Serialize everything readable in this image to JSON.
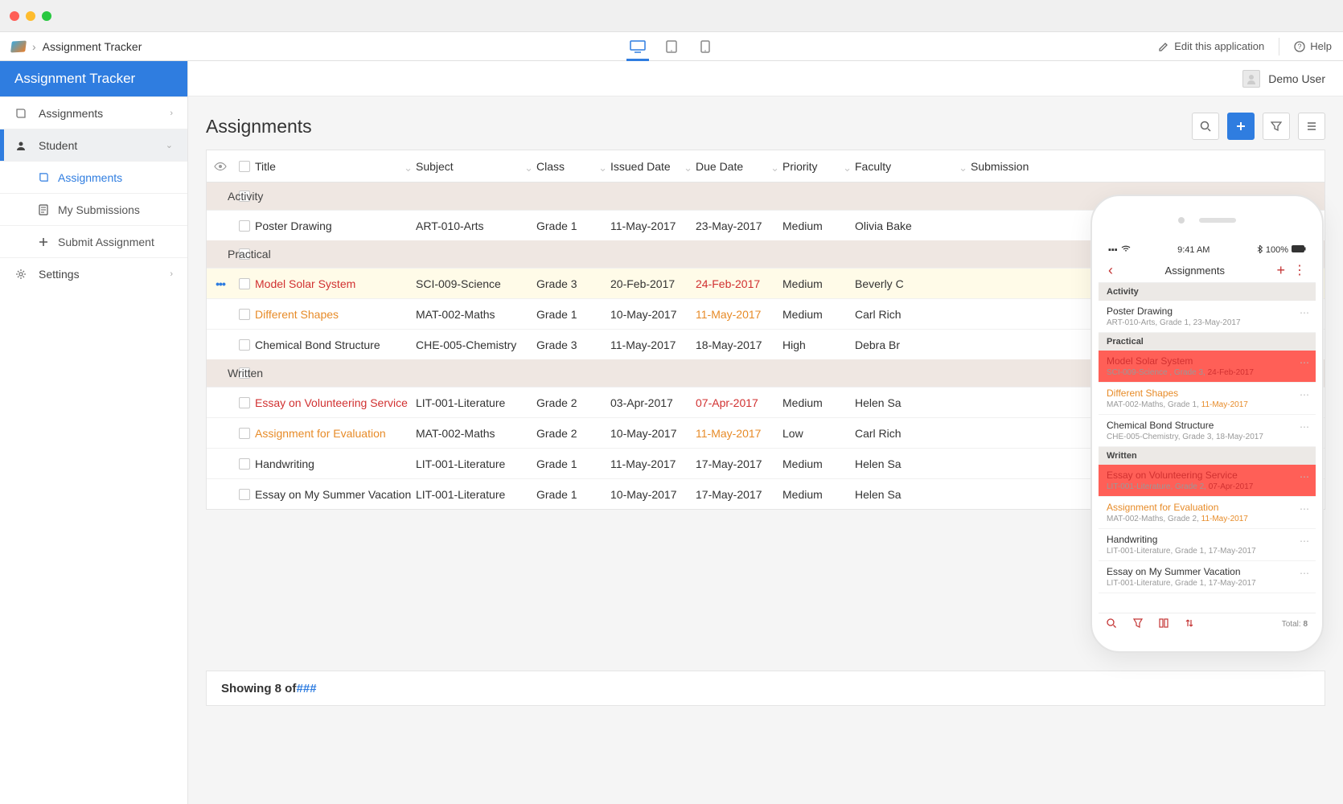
{
  "breadcrumb": {
    "app": "Assignment Tracker"
  },
  "topbar": {
    "edit": "Edit this application",
    "help": "Help"
  },
  "user": {
    "name": "Demo User"
  },
  "sidebar": {
    "brand": "Assignment Tracker",
    "items": [
      {
        "label": "Assignments"
      },
      {
        "label": "Student",
        "children": [
          {
            "label": "Assignments"
          },
          {
            "label": "My Submissions"
          },
          {
            "label": "Submit Assignment"
          }
        ]
      },
      {
        "label": "Settings"
      }
    ]
  },
  "page": {
    "title": "Assignments"
  },
  "columns": {
    "title": "Title",
    "subject": "Subject",
    "class": "Class",
    "issued": "Issued Date",
    "due": "Due Date",
    "priority": "Priority",
    "faculty": "Faculty",
    "submission": "Submission"
  },
  "groups": [
    {
      "name": "Activity",
      "rows": [
        {
          "title": "Poster Drawing",
          "subject": "ART-010-Arts",
          "class": "Grade 1",
          "issued": "11-May-2017",
          "due": "23-May-2017",
          "priority": "Medium",
          "faculty": "Olivia Bake",
          "status": "normal"
        }
      ]
    },
    {
      "name": "Practical",
      "rows": [
        {
          "title": "Model Solar System",
          "subject": "SCI-009-Science",
          "class": "Grade 3",
          "issued": "20-Feb-2017",
          "due": "24-Feb-2017",
          "priority": "Medium",
          "faculty": "Beverly C",
          "status": "red",
          "highlighted": true,
          "indicator": true
        },
        {
          "title": "Different Shapes",
          "subject": "MAT-002-Maths",
          "class": "Grade 1",
          "issued": "10-May-2017",
          "due": "11-May-2017",
          "priority": "Medium",
          "faculty": "Carl Rich",
          "status": "orange"
        },
        {
          "title": "Chemical Bond Structure",
          "subject": "CHE-005-Chemistry",
          "class": "Grade 3",
          "issued": "11-May-2017",
          "due": "18-May-2017",
          "priority": "High",
          "faculty": "Debra Br",
          "status": "normal"
        }
      ]
    },
    {
      "name": "Written",
      "rows": [
        {
          "title": "Essay on Volunteering Service",
          "subject": "LIT-001-Literature",
          "class": "Grade 2",
          "issued": "03-Apr-2017",
          "due": "07-Apr-2017",
          "priority": "Medium",
          "faculty": "Helen Sa",
          "status": "red"
        },
        {
          "title": "Assignment for Evaluation",
          "subject": "MAT-002-Maths",
          "class": "Grade 2",
          "issued": "10-May-2017",
          "due": "11-May-2017",
          "priority": "Low",
          "faculty": "Carl Rich",
          "status": "orange"
        },
        {
          "title": "Handwriting",
          "subject": "LIT-001-Literature",
          "class": "Grade 1",
          "issued": "11-May-2017",
          "due": "17-May-2017",
          "priority": "Medium",
          "faculty": "Helen Sa",
          "status": "normal"
        },
        {
          "title": "Essay on My Summer Vacation",
          "subject": "LIT-001-Literature",
          "class": "Grade 1",
          "issued": "10-May-2017",
          "due": "17-May-2017",
          "priority": "Medium",
          "faculty": "Helen Sa",
          "status": "normal"
        }
      ]
    }
  ],
  "pager": {
    "prefix": "Showing 8 of ",
    "hash": "###"
  },
  "phone": {
    "status": {
      "time": "9:41 AM",
      "battery": "100%"
    },
    "title": "Assignments",
    "groups": [
      {
        "name": "Activity",
        "items": [
          {
            "t": "Poster Drawing",
            "sub": "ART-010-Arts, Grade 1, 23-May-2017",
            "style": "normal"
          }
        ]
      },
      {
        "name": "Practical",
        "items": [
          {
            "t": "Model Solar System",
            "sub": "SCI-009-Science , Grade 3,",
            "date": "24-Feb-2017",
            "style": "red"
          },
          {
            "t": "Different Shapes",
            "sub": "MAT-002-Maths, Grade 1,",
            "date": "11-May-2017",
            "style": "orange"
          },
          {
            "t": "Chemical Bond Structure",
            "sub": "CHE-005-Chemistry, Grade 3, 18-May-2017",
            "style": "normal"
          }
        ]
      },
      {
        "name": "Written",
        "items": [
          {
            "t": "Essay on Volunteering Service",
            "sub": "LIT-001-Literature, Grade 2,",
            "date": "07-Apr-2017",
            "style": "red"
          },
          {
            "t": "Assignment for Evaluation",
            "sub": "MAT-002-Maths, Grade 2,",
            "date": "11-May-2017",
            "style": "orange"
          },
          {
            "t": "Handwriting",
            "sub": "LIT-001-Literature, Grade 1, 17-May-2017",
            "style": "normal"
          },
          {
            "t": "Essay on My Summer Vacation",
            "sub": "LIT-001-Literature, Grade 1, 17-May-2017",
            "style": "normal"
          }
        ]
      }
    ],
    "footer": {
      "total_label": "Total:",
      "total": "8"
    }
  }
}
